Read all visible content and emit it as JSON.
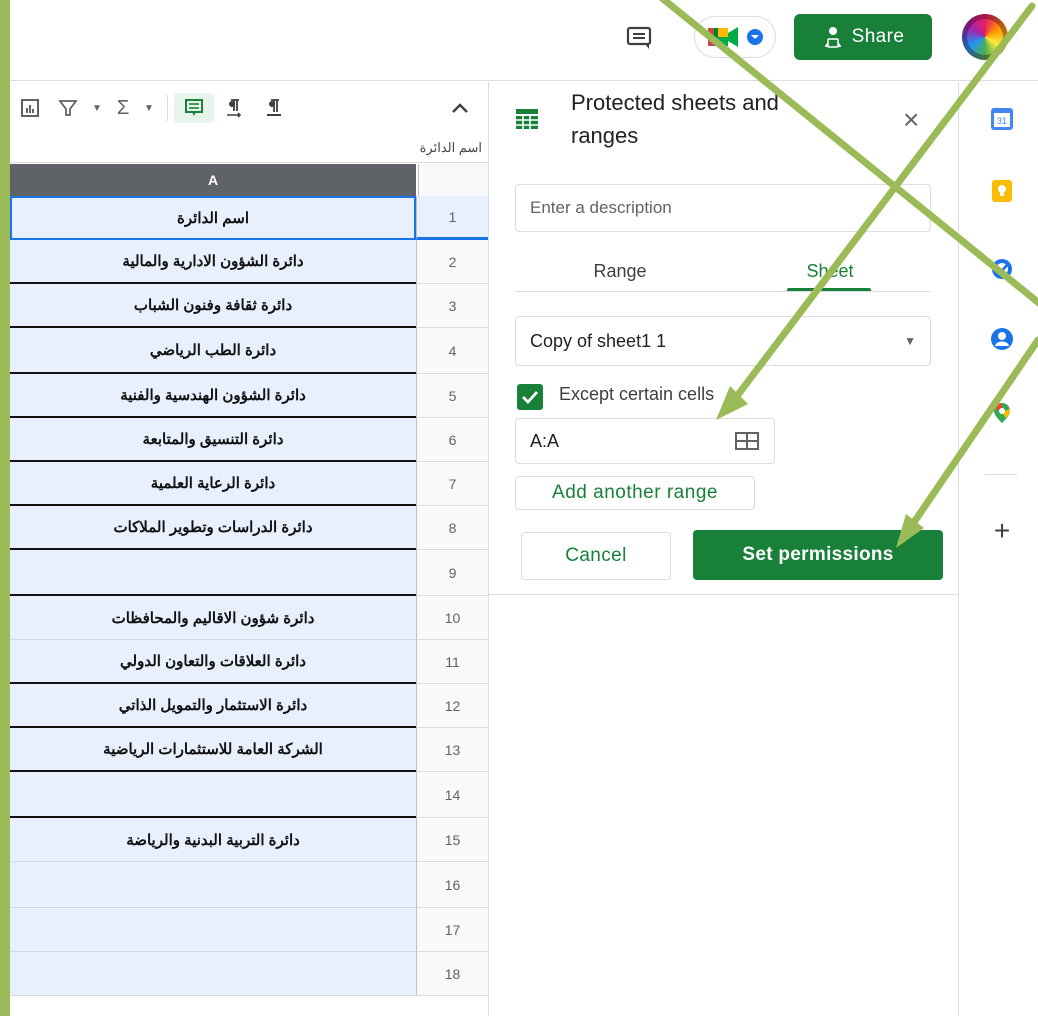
{
  "header": {
    "share_label": "Share"
  },
  "toolbar": {
    "items": [
      "chart-icon",
      "filter-icon",
      "function-icon",
      "comment-icon",
      "text-direction-ltr-icon",
      "text-direction-rtl-icon"
    ],
    "sigma": "Σ"
  },
  "formula_bar": {
    "value": "اسم الدائرة"
  },
  "grid": {
    "column_a": "A",
    "rows": [
      {
        "num": "1",
        "text": "اسم الدائرة"
      },
      {
        "num": "2",
        "text": "دائرة الشؤون الادارية والمالية"
      },
      {
        "num": "3",
        "text": "دائرة ثقافة وفنون الشباب"
      },
      {
        "num": "4",
        "text": "دائرة الطب الرياضي"
      },
      {
        "num": "5",
        "text": "دائرة الشؤون الهندسية والفنية"
      },
      {
        "num": "6",
        "text": "دائرة التنسيق والمتابعة"
      },
      {
        "num": "7",
        "text": "دائرة الرعاية العلمية"
      },
      {
        "num": "8",
        "text": "دائرة الدراسات وتطوير الملاكات"
      },
      {
        "num": "9",
        "text": ""
      },
      {
        "num": "10",
        "text": "دائرة شؤون الاقاليم والمحافظات"
      },
      {
        "num": "11",
        "text": "دائرة العلاقات والتعاون الدولي"
      },
      {
        "num": "12",
        "text": "دائرة الاستثمار والتمويل الذاتي"
      },
      {
        "num": "13",
        "text": "الشركة العامة للاستثمارات الرياضية"
      },
      {
        "num": "14",
        "text": ""
      },
      {
        "num": "15",
        "text": "دائرة التربية البدنية والرياضة"
      },
      {
        "num": "16",
        "text": ""
      },
      {
        "num": "17",
        "text": ""
      },
      {
        "num": "18",
        "text": ""
      }
    ]
  },
  "panel": {
    "title": "Protected sheets and ranges",
    "close": "×",
    "description_placeholder": "Enter a description",
    "tabs": {
      "range": "Range",
      "sheet": "Sheet",
      "active": "sheet"
    },
    "sheet_selected": "Copy of sheet1 1",
    "except_checked": true,
    "except_label": "Except certain cells",
    "range_value": "A:A",
    "add_range_label": "Add another range",
    "cancel_label": "Cancel",
    "set_permissions_label": "Set permissions"
  },
  "side_rail": {
    "icons": [
      "calendar-icon",
      "keep-icon",
      "tasks-icon",
      "contacts-icon",
      "maps-icon"
    ],
    "calendar_day": "31",
    "add_label": "+"
  },
  "colors": {
    "accent": "#188038",
    "selection": "#e8f0fe",
    "annotation_arrows": "#9bbb59"
  }
}
